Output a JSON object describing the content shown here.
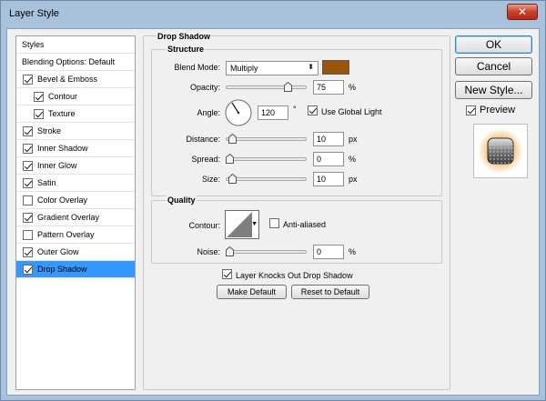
{
  "window": {
    "title": "Layer Style",
    "close_glyph": "✕"
  },
  "styles_list": {
    "header": "Styles",
    "blending": "Blending Options: Default",
    "items": [
      {
        "label": "Bevel & Emboss",
        "checked": true,
        "indent": false
      },
      {
        "label": "Contour",
        "checked": true,
        "indent": true
      },
      {
        "label": "Texture",
        "checked": true,
        "indent": true
      },
      {
        "label": "Stroke",
        "checked": true,
        "indent": false
      },
      {
        "label": "Inner Shadow",
        "checked": true,
        "indent": false
      },
      {
        "label": "Inner Glow",
        "checked": true,
        "indent": false
      },
      {
        "label": "Satin",
        "checked": true,
        "indent": false
      },
      {
        "label": "Color Overlay",
        "checked": false,
        "indent": false
      },
      {
        "label": "Gradient Overlay",
        "checked": true,
        "indent": false
      },
      {
        "label": "Pattern Overlay",
        "checked": false,
        "indent": false
      },
      {
        "label": "Outer Glow",
        "checked": true,
        "indent": false
      },
      {
        "label": "Drop Shadow",
        "checked": true,
        "indent": false,
        "selected": true
      }
    ]
  },
  "panel": {
    "section_title": "Drop Shadow",
    "structure": {
      "title": "Structure",
      "blend_mode_label": "Blend Mode:",
      "blend_mode_value": "Multiply",
      "blend_color": "#9c5508",
      "opacity_label": "Opacity:",
      "opacity_value": "75",
      "opacity_unit": "%",
      "opacity_fraction": 0.75,
      "angle_label": "Angle:",
      "angle_value": "120",
      "angle_unit": "°",
      "use_global_light_label": "Use Global Light",
      "use_global_light": true,
      "distance_label": "Distance:",
      "distance_value": "10",
      "distance_unit": "px",
      "spread_label": "Spread:",
      "spread_value": "0",
      "spread_unit": "%",
      "size_label": "Size:",
      "size_value": "10",
      "size_unit": "px"
    },
    "quality": {
      "title": "Quality",
      "contour_label": "Contour:",
      "anti_aliased_label": "Anti-aliased",
      "anti_aliased": false,
      "noise_label": "Noise:",
      "noise_value": "0",
      "noise_unit": "%"
    },
    "knocks_out_label": "Layer Knocks Out Drop Shadow",
    "knocks_out": true,
    "make_default_label": "Make Default",
    "reset_default_label": "Reset to Default"
  },
  "actions": {
    "ok_label": "OK",
    "cancel_label": "Cancel",
    "new_style_label": "New Style...",
    "preview_label": "Preview",
    "preview_checked": true
  }
}
